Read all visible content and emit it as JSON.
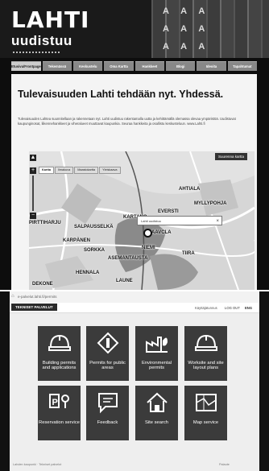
{
  "top_site": {
    "logo_line1": "LAHTI",
    "logo_line2": "uudistuu",
    "pattern_letters": "A A A",
    "nav": [
      {
        "label": "Etusivu/Frontpage",
        "active": true
      },
      {
        "label": "Tekemässä",
        "active": false
      },
      {
        "label": "Keskustelu",
        "active": false
      },
      {
        "label": "Oma Kartta",
        "active": false
      },
      {
        "label": "Hankkeet",
        "active": false
      },
      {
        "label": "Blogi",
        "active": false
      },
      {
        "label": "Ideoita",
        "active": false
      },
      {
        "label": "Tapahtumat",
        "active": false
      }
    ],
    "heading": "Tulevaisuuden Lahti tehdään nyt. Yhdessä.",
    "intro": "Tulevaisuuden Lahtea suunnitellaan ja rakennetaan nyt. Lahti uudistuu rakentamalla uutta ja kehittämällä olemassa olevaa ympäristöä. Uudistuvat kaupunginosat, liikennehankkeet ja viheralueet muuttavat kaupunkia. Seuraa hankkeita ja osallistu keskusteluun. www.Lahti.fi",
    "map": {
      "tabs": [
        {
          "label": "Kartta",
          "active": true
        },
        {
          "label": "Ilmakuva",
          "active": false
        },
        {
          "label": "Maastokartta",
          "active": false
        },
        {
          "label": "Yleiskaava",
          "active": false
        }
      ],
      "enlarge_button": "Suurenna kartta",
      "popup_text": "Lahti uudistuu",
      "places": [
        "AHTIALA",
        "MYLLYPOHJA",
        "KARTANO",
        "EVERSTI",
        "PIRTTIHARJU",
        "SALPAUSSELKÄ",
        "KARPÄNEN",
        "SORKKA",
        "AAVCLA",
        "ASEMANTAUSTA",
        "NIEMI",
        "TIIRA",
        "HENNALA",
        "LAUNE",
        "DEKONE"
      ]
    }
  },
  "service": {
    "address": "e-palvelut.lahti.fi/permits",
    "brand": "TEKNISET PALVELUT",
    "user": "Käyttäjätunnus",
    "logout": "LOG OUT",
    "lang": "ENG",
    "tiles": [
      {
        "icon": "hardhat-icon",
        "label": "Building permits and applications"
      },
      {
        "icon": "sign-icon",
        "label": "Permits for public areas"
      },
      {
        "icon": "factory-icon",
        "label": "Environmental permits"
      },
      {
        "icon": "hardhat-icon",
        "label": "Worksite and site layout plans"
      },
      {
        "icon": "parking-icon",
        "label": "Reservation service"
      },
      {
        "icon": "feedback-icon",
        "label": "Feedback"
      },
      {
        "icon": "home-icon",
        "label": "Site search"
      },
      {
        "icon": "map-icon",
        "label": "Map service"
      }
    ],
    "footer_left": "Lahden kaupunki · Tekniset palvelut",
    "footer_right": "Palaute"
  }
}
